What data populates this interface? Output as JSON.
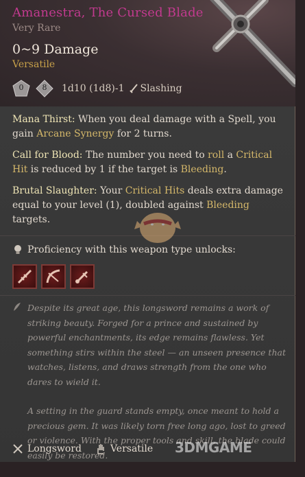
{
  "item": {
    "name": "Amanestra, The Cursed Blade",
    "rarity": "Very Rare",
    "damage": "0~9 Damage",
    "property": "Versatile",
    "dice": [
      "0",
      "8"
    ],
    "damage_formula": "1d10 (1d8)-1",
    "damage_type": "Slashing"
  },
  "abilities": [
    {
      "name": "Mana Thirst:",
      "parts": [
        "When you deal damage with a Spell, you gain ",
        "Arcane Synergy",
        " for 2 turns."
      ]
    },
    {
      "name": "Call for Blood:",
      "parts": [
        "The number you need to ",
        "roll",
        " a ",
        "Critical Hit",
        " is reduced by 1 if the target is ",
        "Bleeding",
        "."
      ]
    },
    {
      "name": "Brutal Slaughter:",
      "parts": [
        "Your ",
        "Critical Hits",
        " deals extra damage equal to your level (1), doubled against ",
        "Bleeding",
        " targets."
      ]
    }
  ],
  "proficiency": {
    "label": "Proficiency with this weapon type unlocks:",
    "actions": [
      "lacerate-icon",
      "cleave-icon",
      "pommel-strike-icon"
    ]
  },
  "lore": [
    "Despite its great age, this longsword remains a work of striking beauty. Forged for a prince and sustained by powerful enchantments, its edge remains flawless. Yet something stirs within the steel — an unseen presence that watches, listens, and draws strength from the one who dares to wield it.",
    "A setting in the guard stands empty, once meant to hold a precious gem. It was likely torn free long ago, lost to greed or violence. With the proper tools and skill, the blade could easily be restored."
  ],
  "footer": {
    "weapon_type": "Longsword",
    "property": "Versatile"
  },
  "watermark": "3DMGAME",
  "colors": {
    "title": "#c23a8f",
    "keyword": "#d5b86a",
    "ability_name": "#f0e6b6",
    "property": "#c9a24a"
  }
}
